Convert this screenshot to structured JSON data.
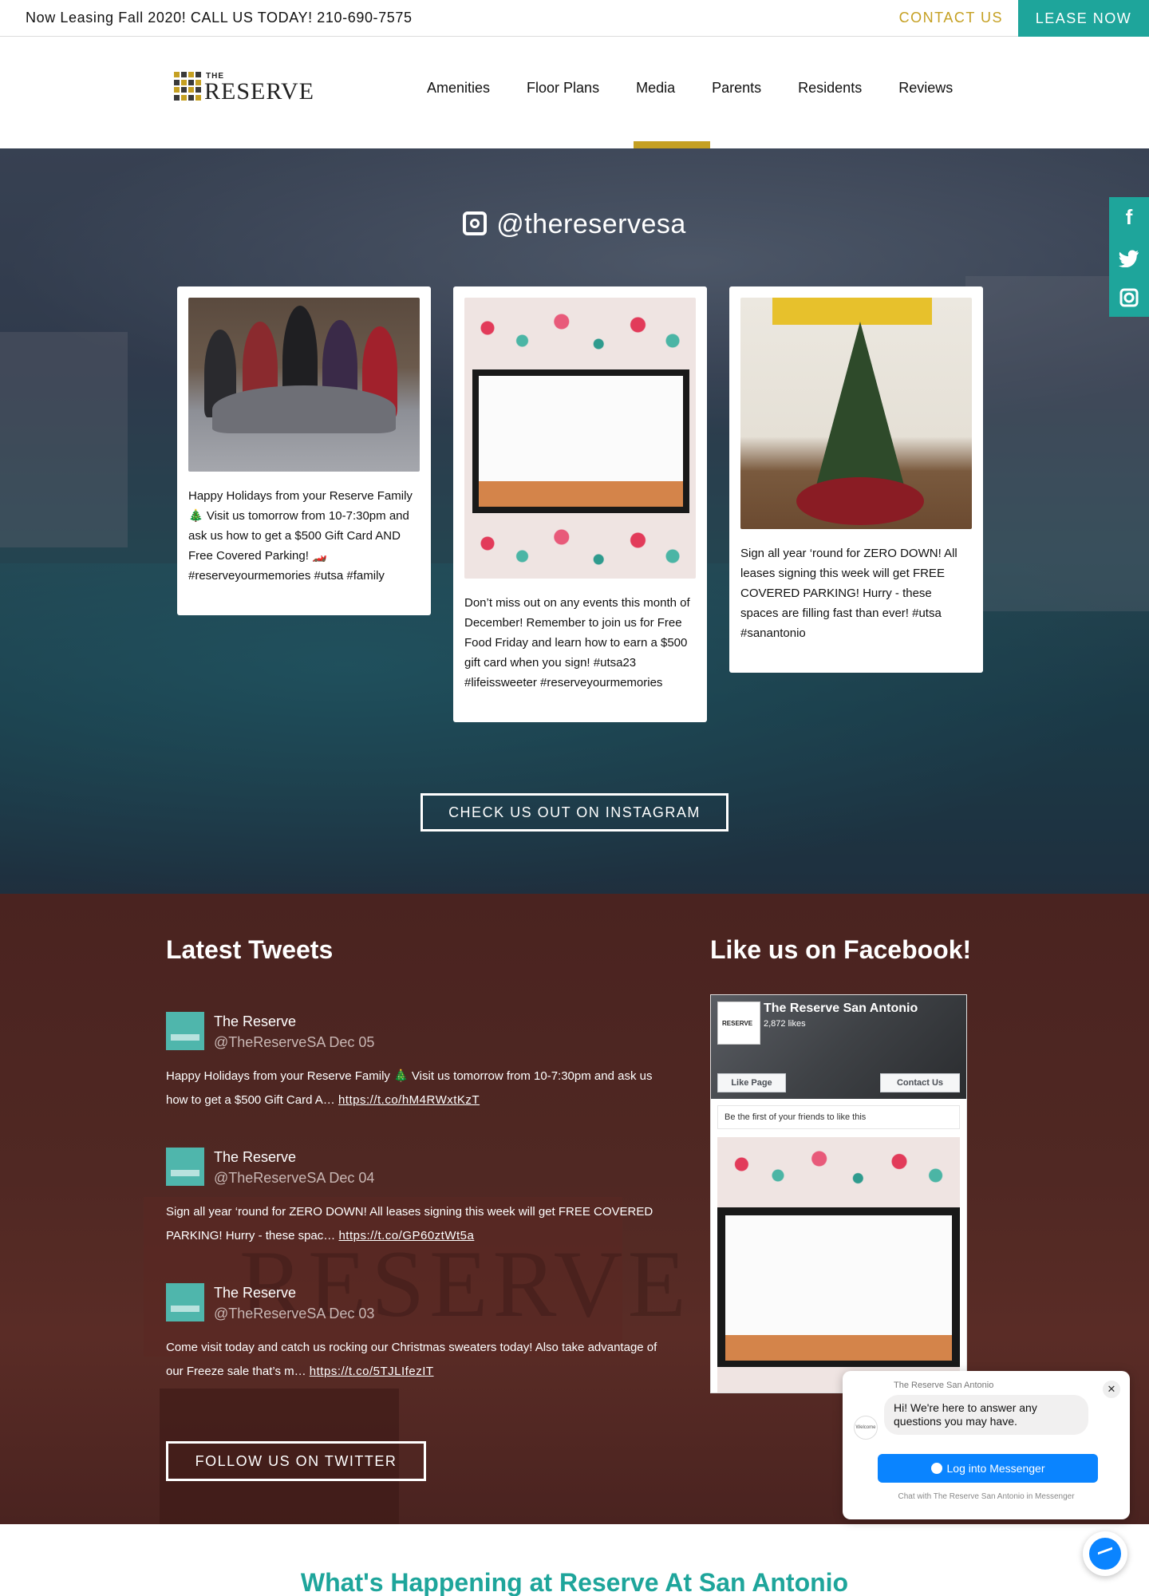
{
  "topbar": {
    "promo": "Now Leasing Fall 2020! CALL US TODAY! 210-690-7575",
    "contact": "CONTACT US",
    "lease": "LEASE NOW"
  },
  "logo": {
    "the": "THE",
    "name": "RESERVE"
  },
  "nav": {
    "items": [
      {
        "label": "Amenities"
      },
      {
        "label": "Floor Plans"
      },
      {
        "label": "Media"
      },
      {
        "label": "Parents"
      },
      {
        "label": "Residents"
      },
      {
        "label": "Reviews"
      }
    ],
    "active": "Media"
  },
  "social_rail": {
    "facebook": "f",
    "twitter": "twitter-icon",
    "instagram": "instagram-icon"
  },
  "instagram": {
    "handle": "@thereservesa",
    "posts": [
      {
        "caption": "Happy Holidays from your Reserve Family 🎄 Visit us tomorrow from 10-7:30pm and ask us how to get a $500 Gift Card AND Free Covered Parking! 🏎️ #reserveyourmemories #utsa #family"
      },
      {
        "caption": "Don’t miss out on any events this month of December! Remember to join us for Free Food Friday and learn how to earn a $500 gift card when you sign! #utsa23 #lifeissweeter #reserveyourmemories"
      },
      {
        "caption": "Sign all year ‘round for ZERO DOWN! All leases signing this week will get FREE COVERED PARKING! Hurry - these spaces are filling fast than ever! #utsa #sanantonio"
      }
    ],
    "button": "CHECK US OUT ON INSTAGRAM"
  },
  "tweets": {
    "heading": "Latest Tweets",
    "items": [
      {
        "name": "The Reserve",
        "handle": "@TheReserveSA Dec 05",
        "text": "Happy Holidays from your Reserve Family 🎄  Visit us tomorrow from 10-7:30pm and ask us how to get a $500 Gift Card A… ",
        "link": "https://t.co/hM4RWxtKzT"
      },
      {
        "name": "The Reserve",
        "handle": "@TheReserveSA Dec 04",
        "text": "Sign all year ‘round for ZERO DOWN! All leases signing this week will get FREE COVERED PARKING! Hurry - these spac… ",
        "link": "https://t.co/GP60ztWt5a"
      },
      {
        "name": "The Reserve",
        "handle": "@TheReserveSA Dec 03",
        "text": "Come visit today and catch us rocking our Christmas sweaters today! Also take advantage of our Freeze sale that’s m… ",
        "link": "https://t.co/5TJLIfezIT"
      }
    ],
    "button": "FOLLOW US ON TWITTER"
  },
  "facebook": {
    "heading": "Like us on Facebook!",
    "page_name": "The Reserve San Antonio",
    "likes": "2,872 likes",
    "thumb_text": "RESERVE",
    "like_button": "Like Page",
    "contact_button": "Contact Us",
    "friends_text": "Be the first of your friends to like this"
  },
  "messenger": {
    "from": "The Reserve San Antonio",
    "message": "Hi! We're here to answer any questions you may have.",
    "avatar_text": "Welcome",
    "login": "Log into Messenger",
    "chat_note": "Chat with The Reserve San Antonio in Messenger",
    "close": "✕"
  },
  "happening": {
    "heading": "What's Happening at Reserve At San Antonio"
  },
  "colors": {
    "teal": "#1ea59b",
    "gold": "#c5a022",
    "messenger": "#0a84ff"
  }
}
